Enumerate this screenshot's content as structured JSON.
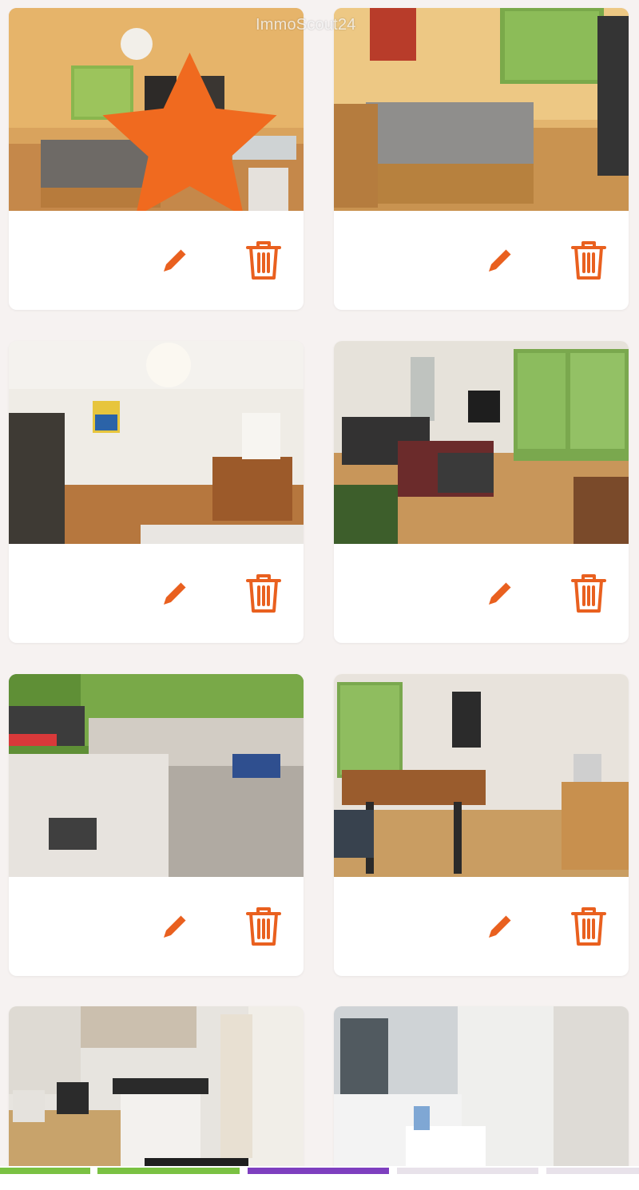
{
  "watermark": "ImmoScout24",
  "colors": {
    "accent": "#e9601f",
    "progress_green": "#7ac142",
    "progress_purple": "#7e3fbf",
    "progress_empty": "#e8e2ea"
  },
  "icons": {
    "edit": "pencil-icon",
    "delete": "trash-icon",
    "main_photo": "star-icon"
  },
  "photos": [
    {
      "scene": "bedroom-desk",
      "is_main": true
    },
    {
      "scene": "bedroom-window",
      "is_main": false
    },
    {
      "scene": "bedroom-dresser",
      "is_main": false
    },
    {
      "scene": "living-room",
      "is_main": false
    },
    {
      "scene": "balcony-sofa",
      "is_main": false
    },
    {
      "scene": "dining-table",
      "is_main": false
    },
    {
      "scene": "kitchen",
      "is_main": false
    },
    {
      "scene": "bathroom",
      "is_main": false
    }
  ]
}
